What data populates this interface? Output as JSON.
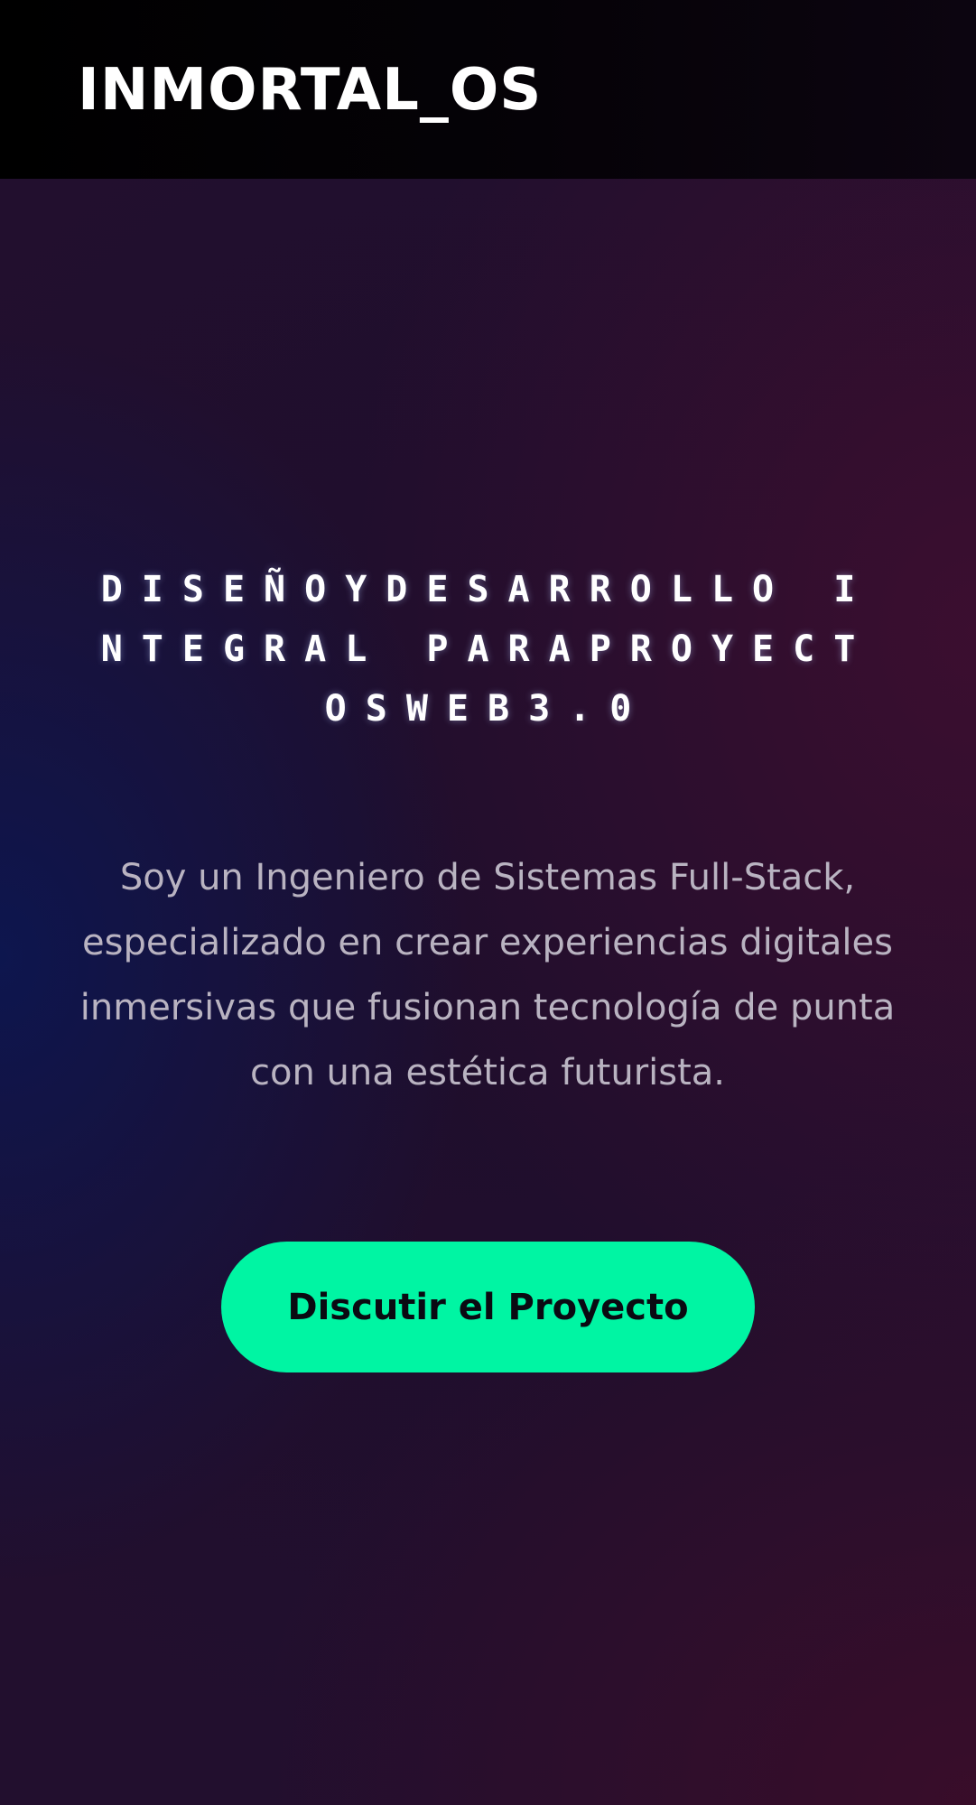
{
  "header": {
    "brand": "INMORTAL_OS"
  },
  "hero": {
    "title": "DISEÑOYDESARROLLO INTEGRAL PARAPROYECTOSWEB3.0",
    "description": "Soy un Ingeniero de Sistemas Full-Stack, especializado en crear experiencias digitales inmersivas que fusionan tecnología de punta con una estética futurista.",
    "cta_label": "Discutir el Proyecto"
  },
  "colors": {
    "accent": "#00f5a3",
    "header_bg": "#000000",
    "text_primary": "#ffffff",
    "text_muted": "#b9b3c1",
    "bg_blue": "#0c1650",
    "bg_magenta": "#3a0c2e"
  }
}
